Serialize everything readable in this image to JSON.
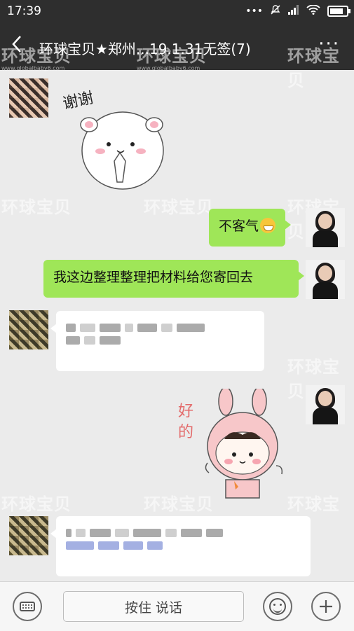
{
  "status_bar": {
    "time": "17:39",
    "icons": [
      "more-dots-icon",
      "mute-icon",
      "signal-icon",
      "wifi-icon",
      "battery-icon"
    ]
  },
  "header": {
    "back_icon": "chevron-left-icon",
    "title": "环球宝贝★郑州...19.1.31无签(7)",
    "more_icon": "ellipsis-icon"
  },
  "messages": [
    {
      "side": "left",
      "type": "sticker",
      "sticker_text": "谢谢"
    },
    {
      "side": "right",
      "type": "text",
      "text": "不客气",
      "emoji": "grin-emoji"
    },
    {
      "side": "right",
      "type": "text",
      "text": "我这边整理整理把材料给您寄回去"
    },
    {
      "side": "left",
      "type": "text",
      "text": "",
      "note": "pixelated"
    },
    {
      "side": "right",
      "type": "sticker",
      "sticker_text": "好的"
    },
    {
      "side": "left",
      "type": "text",
      "text": "",
      "note": "pixelated"
    }
  ],
  "watermark": {
    "text": "环球宝贝",
    "url": "www.globalbaby6.com"
  },
  "input_bar": {
    "keyboard_icon": "keyboard-icon",
    "hold_to_talk": "按住 说话",
    "emoji_icon": "smiley-icon",
    "plus_icon": "plus-icon"
  },
  "colors": {
    "header_bg": "#2e2e2e",
    "chat_bg": "#ebebeb",
    "bubble_green": "#9fe658",
    "bubble_white": "#ffffff"
  }
}
